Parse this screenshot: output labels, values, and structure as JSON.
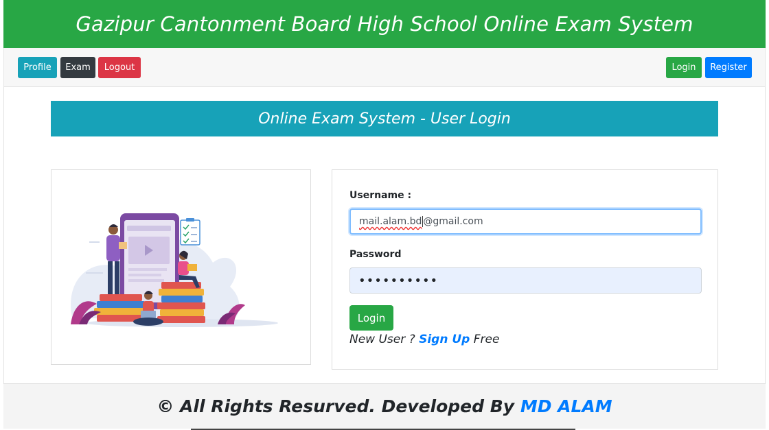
{
  "header": {
    "title": "Gazipur Cantonment Board High School Online Exam System",
    "background_color": "#28a745"
  },
  "navbar": {
    "left_buttons": [
      {
        "label": "Profile",
        "color": "#17a2b8"
      },
      {
        "label": "Exam",
        "color": "#343a40"
      },
      {
        "label": "Logout",
        "color": "#dc3545"
      }
    ],
    "right_buttons": [
      {
        "label": "Login",
        "color": "#28a745"
      },
      {
        "label": "Register",
        "color": "#007bff"
      }
    ]
  },
  "login_panel": {
    "title": "Online Exam System - User Login",
    "title_color": "#17a2b8",
    "username_label": "Username :",
    "username_typo_part": "mail.alam.bd",
    "username_rest": "@gmail.com",
    "password_label": "Password",
    "password_mask": "••••••••••",
    "submit_label": "Login",
    "signup_prefix": "New User ?",
    "signup_link": "Sign Up",
    "signup_suffix": "Free"
  },
  "illustration": {
    "icon": "students-with-books-illustration"
  },
  "footer": {
    "text": "© All Rights Resurved. Developed By",
    "developer": "MD ALAM",
    "link_color": "#007bff"
  }
}
